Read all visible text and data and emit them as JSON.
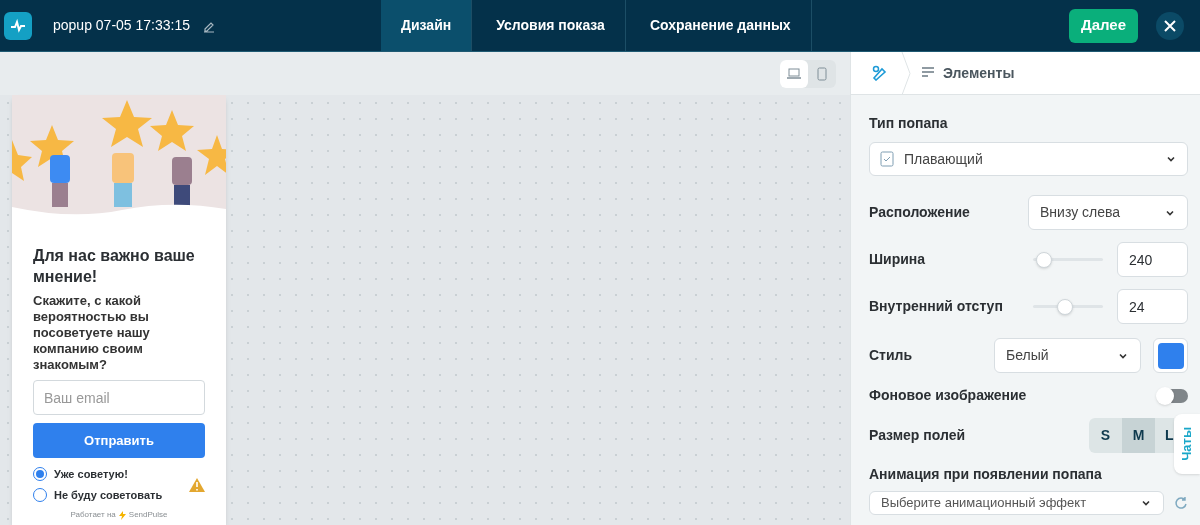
{
  "header": {
    "title": "popup 07-05 17:33:15",
    "next_button": "Далее"
  },
  "steps": [
    {
      "label": "Дизайн",
      "selected": true
    },
    {
      "label": "Условия показа",
      "selected": false
    },
    {
      "label": "Сохранение данных",
      "selected": false
    }
  ],
  "devices": [
    {
      "kind": "desktop",
      "selected": true
    },
    {
      "kind": "mobile",
      "selected": false
    }
  ],
  "popup": {
    "heading": "Для нас важно ваше мнение!",
    "text": "Скажите, с какой вероятностью вы посоветуете нашу компанию своим знакомым?",
    "email_placeholder": "Ваш email",
    "submit": "Отправить",
    "options": [
      {
        "label": "Уже советую!",
        "selected": true
      },
      {
        "label": "Не буду советовать",
        "selected": false
      }
    ],
    "footer": "Работает на",
    "brand": "SendPulse"
  },
  "panel": {
    "breadcrumb": "Элементы",
    "popup_type": {
      "label": "Тип попапа",
      "value": "Плавающий"
    },
    "position": {
      "label": "Расположение",
      "value": "Внизу слева"
    },
    "width": {
      "label": "Ширина",
      "level": 0.05,
      "value": "240"
    },
    "padding": {
      "label": "Внутренний отступ",
      "level": 0.45,
      "value": "24"
    },
    "style": {
      "label": "Стиль",
      "value": "Белый",
      "color": "#2f80ed"
    },
    "background_image": {
      "label": "Фоновое изображение",
      "on": false
    },
    "field_size": {
      "label": "Размер полей",
      "options": [
        {
          "label": "S",
          "selected": false
        },
        {
          "label": "M",
          "selected": true
        },
        {
          "label": "L",
          "selected": false
        }
      ]
    },
    "animation": {
      "label": "Анимация при появлении попапа",
      "placeholder": "Выберите анимационный эффект"
    }
  },
  "chat_tab": "Чаты"
}
